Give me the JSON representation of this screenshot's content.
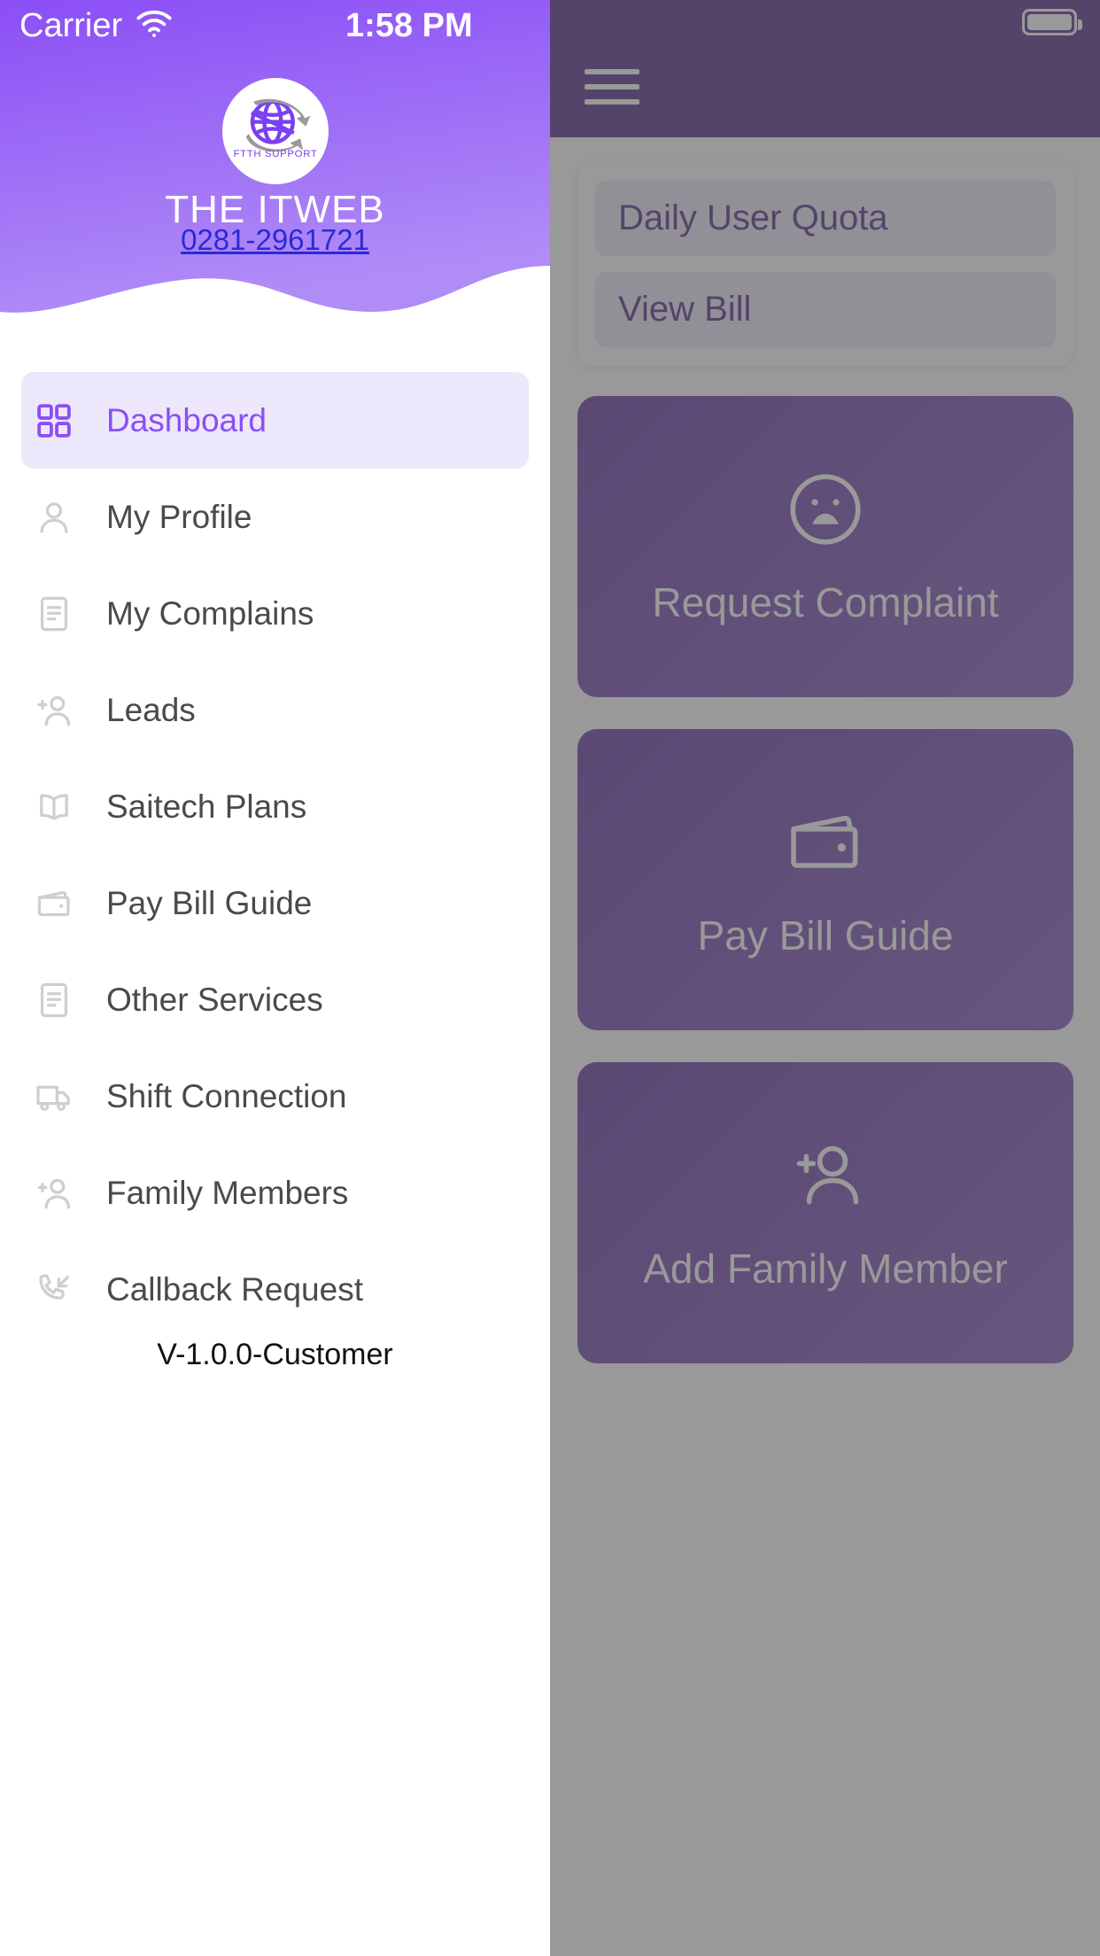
{
  "status_bar": {
    "carrier": "Carrier",
    "wifi_icon": "wifi-icon",
    "time": "1:58 PM",
    "battery_icon": "battery-icon"
  },
  "drawer": {
    "brand_title": "THE ITWEB",
    "brand_phone": "0281-2961721",
    "logo_caption": "FTTH SUPPORT",
    "version": "V-1.0.0-Customer",
    "header_gradient_from": "#8b4ef5",
    "header_gradient_to": "#b08cf7",
    "active_bg": "#ece7fb",
    "active_color": "#8b4ef5",
    "items": [
      {
        "label": "Dashboard",
        "icon": "grid-icon",
        "active": true
      },
      {
        "label": "My Profile",
        "icon": "person-icon",
        "active": false
      },
      {
        "label": "My Complains",
        "icon": "document-icon",
        "active": false
      },
      {
        "label": "Leads",
        "icon": "person-add-icon",
        "active": false
      },
      {
        "label": "Saitech Plans",
        "icon": "book-icon",
        "active": false
      },
      {
        "label": "Pay Bill Guide",
        "icon": "wallet-icon",
        "active": false
      },
      {
        "label": "Other Services",
        "icon": "document-icon",
        "active": false
      },
      {
        "label": "Shift Connection",
        "icon": "truck-icon",
        "active": false
      },
      {
        "label": "Family Members",
        "icon": "person-add-icon",
        "active": false
      },
      {
        "label": "Callback Request",
        "icon": "phone-incoming-icon",
        "active": false
      }
    ]
  },
  "background": {
    "appbar_color": "#4a2184",
    "menu_icon": "hamburger-icon",
    "quick_actions": [
      {
        "label": "Daily User Quota"
      },
      {
        "label": "View Bill"
      }
    ],
    "tiles": [
      {
        "label": "Request Complaint",
        "icon": "sad-face-icon"
      },
      {
        "label": "Pay Bill Guide",
        "icon": "wallet-icon"
      },
      {
        "label": "Add Family Member",
        "icon": "person-add-icon"
      }
    ]
  }
}
